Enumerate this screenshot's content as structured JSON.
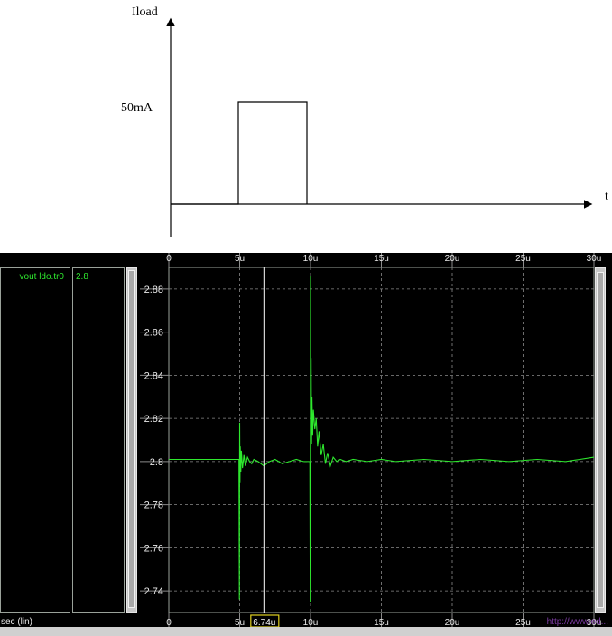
{
  "diagram": {
    "y_label": "Iload",
    "x_label": "t",
    "level_label": "50mA",
    "pulse": {
      "start_us": 5,
      "end_us": 10,
      "amplitude_mA": 50
    }
  },
  "signals": [
    {
      "name": "vout ldo.tr0",
      "value": "2.8",
      "color": "#2ee82e"
    }
  ],
  "axis": {
    "x_unit_label": "sec (lin)",
    "cursor_readout": "6.74u",
    "cursor_value_us": 6.74
  },
  "watermark": "http://www.ed...",
  "chart_data": {
    "type": "line",
    "title": "",
    "xlabel": "sec (lin)",
    "ylabel": "",
    "xlim": [
      0,
      30
    ],
    "ylim": [
      2.73,
      2.89
    ],
    "x_ticks": [
      0,
      5,
      10,
      15,
      20,
      25,
      30
    ],
    "x_tick_labels": [
      "0",
      "5u",
      "10u",
      "15u",
      "20u",
      "25u",
      "30u"
    ],
    "y_ticks": [
      2.74,
      2.76,
      2.78,
      2.8,
      2.82,
      2.84,
      2.86,
      2.88
    ],
    "y_tick_labels": [
      "2.74",
      "2.76",
      "2.78",
      "2.8",
      "2.82",
      "2.84",
      "2.86",
      "2.88"
    ],
    "grid": true,
    "series": [
      {
        "name": "vout ldo.tr0",
        "color": "#2ee82e",
        "x": [
          0,
          4.95,
          4.98,
          5.0,
          5.02,
          5.04,
          5.08,
          5.12,
          5.2,
          5.3,
          5.4,
          5.55,
          5.7,
          5.85,
          6.0,
          6.3,
          6.7,
          7.1,
          7.5,
          8.0,
          8.5,
          9.0,
          9.5,
          9.95,
          9.98,
          10.0,
          10.02,
          10.04,
          10.07,
          10.1,
          10.15,
          10.2,
          10.3,
          10.4,
          10.5,
          10.6,
          10.75,
          10.9,
          11.05,
          11.2,
          11.4,
          11.6,
          11.85,
          12.1,
          12.5,
          13.0,
          14.0,
          15.0,
          16.0,
          18.0,
          20.0,
          22.0,
          24.0,
          26.0,
          28.0,
          29.0,
          30.0
        ],
        "y": [
          2.801,
          2.801,
          2.736,
          2.818,
          2.79,
          2.807,
          2.795,
          2.805,
          2.797,
          2.803,
          2.798,
          2.802,
          2.8,
          2.799,
          2.801,
          2.8,
          2.798,
          2.8,
          2.801,
          2.799,
          2.8,
          2.801,
          2.8,
          2.8,
          2.735,
          2.886,
          2.77,
          2.848,
          2.808,
          2.83,
          2.812,
          2.824,
          2.815,
          2.82,
          2.807,
          2.814,
          2.803,
          2.808,
          2.799,
          2.804,
          2.798,
          2.802,
          2.8,
          2.801,
          2.8,
          2.801,
          2.8,
          2.801,
          2.8,
          2.801,
          2.8,
          2.801,
          2.8,
          2.801,
          2.8,
          2.801,
          2.802
        ]
      }
    ]
  }
}
